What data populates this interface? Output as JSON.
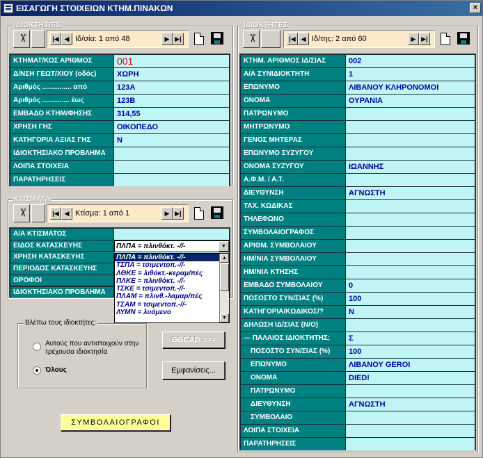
{
  "window": {
    "title": "ΕΙΣΑΓΩΓΗ ΣΤΟΙΧΕΙΩΝ ΚΤΗΜ.ΠΙΝΑΚΩΝ",
    "close": "×"
  },
  "properties_group": {
    "label": "ΙΔΙΟΚΤΗΣΙΕΣ",
    "nav": {
      "first": "|◀",
      "prev": "◀",
      "text": "Ιδ/σία: 1 από 48",
      "next": "▶",
      "last": "▶|"
    },
    "rows": [
      {
        "label": "ΚΤΗΜΑΤ/ΚΟΣ ΑΡΙΘΜΟΣ",
        "value": "001"
      },
      {
        "label": "Δ/ΝΣΗ ΓΕΩΤ/ΧΙΟΥ (οδός)",
        "value": "ΧΩΡΗ"
      },
      {
        "label": "Αριθμός ............... από",
        "value": "123A"
      },
      {
        "label": "Αριθμός .............. έως",
        "value": "123B"
      },
      {
        "label": "ΕΜΒΑΔΟ ΚΤΗΜ/ΦΗΣΗΣ",
        "value": "314,55"
      },
      {
        "label": "ΧΡΗΣΗ ΓΗΣ",
        "value": "ΟΙΚΟΠΕΔΟ"
      },
      {
        "label": "ΚΑΤΗΓΟΡΙΑ ΑΞΙΑΣ ΓΗΣ",
        "value": "N"
      },
      {
        "label": "ΙΔΙΟΚΤΗΣΙΑΚΟ ΠΡΟΒΛΗΜΑ",
        "value": ""
      },
      {
        "label": "ΛΟΙΠΑ ΣΤΟΙΧΕΙΑ",
        "value": ""
      },
      {
        "label": "ΠΑΡΑΤΗΡΗΣΕΙΣ",
        "value": ""
      }
    ]
  },
  "buildings_group": {
    "label": "ΚΤΙΣΜΑΤΑ",
    "nav": {
      "first": "|◀",
      "prev": "◀",
      "text": "Κτίσμα: 1 από 1",
      "next": "▶",
      "last": "▶|"
    },
    "rows": [
      {
        "label": "Α/Α ΚΤΙΣΜΑΤΟΣ"
      },
      {
        "label": "ΕΙΔΟΣ ΚΑΤΑΣΚΕΥΗΣ"
      },
      {
        "label": "ΧΡΗΣΗ ΚΑΤΑΣΚΕΥΗΣ"
      },
      {
        "label": "ΠΕΡΙΟΔΟΣ ΚΑΤΑΣΚΕΥΗΣ"
      },
      {
        "label": "ΟΡΟΦΟΙ"
      },
      {
        "label": "ΙΔΙΟΚΤΗΣΙΑΚΟ ΠΡΟΒΛΗΜΑ"
      }
    ],
    "combo_value": "ΠΛΠΑ = πλινθόκτ. -//-",
    "combo_arrow": "▼",
    "options": [
      "ΠΛΠΑ = πλινθόκτ. -//-",
      "ΤΣΠΑ = τσιμεντοπ.-//-",
      "ΛΘΚΕ = λιθόκτ.-κεραμ/πές",
      "ΠΛΚΕ = πλινθόκτ. -//-",
      "ΤΣΚΕ = τσιμεντοπ.-//-",
      "ΠΛΑΜ = πλινθ.-λαμαρ/πές",
      "ΤΣΑΜ = τσιμεντοπ.-//-",
      "ΛΥΜΝ = λυόμενο"
    ],
    "scroll_up": "▲",
    "scroll_down": "▼"
  },
  "view_owners": {
    "label": "Βλέπω τους ιδιοκτήτες:",
    "option1": "Αυτούς που αντιστοιχούν στην τρέχουσα ιδιοκτησία",
    "option2": "Όλους"
  },
  "buttons": {
    "ggcad": "GGCAD >>>",
    "display": "Εμφανίσεις...",
    "notaries": "ΣΥΜΒΟΛΑΙΟΓΡΑΦΟΙ"
  },
  "owners_group": {
    "label": "ΙΔΙΟΚΤΗΤΕΣ",
    "nav": {
      "first": "|◀",
      "prev": "◀",
      "text": "Ιδ/της: 2 από 60",
      "next": "▶",
      "last": "▶|"
    },
    "rows": [
      {
        "label": "ΚΤΗΜ. ΑΡΙΘΜΟΣ ΙΔ/ΣΙΑΣ",
        "value": "002"
      },
      {
        "label": "Α/Α ΣΥΝΙΔΙΟΚΤΗΤΗ",
        "value": "1"
      },
      {
        "label": "ΕΠΩΝΥΜΟ",
        "value": "ΛΙΒΑΝΟΥ ΚΛΗΡΟΝΟΜΟΙ"
      },
      {
        "label": "ΟΝΟΜΑ",
        "value": "ΟΥΡΑΝΙΑ"
      },
      {
        "label": "ΠΑΤΡΩΝΥΜΟ",
        "value": ""
      },
      {
        "label": "ΜΗΤΡΩΝΥΜΟ",
        "value": ""
      },
      {
        "label": "ΓΕΝΟΣ ΜΗΤΕΡΑΣ",
        "value": ""
      },
      {
        "label": "ΕΠΩΝΥΜΟ ΣΥΖΥΓΟΥ",
        "value": ""
      },
      {
        "label": "ΟΝΟΜΑ ΣΥΖΥΓΟΥ",
        "value": "ΙΩΑΝΝΗΣ"
      },
      {
        "label": "Α.Φ.Μ. / Α.Τ.",
        "value": ""
      },
      {
        "label": "ΔΙΕΥΘΥΝΣΗ",
        "value": "ΑΓΝΩΣΤΗ"
      },
      {
        "label": "ΤΑΧ. ΚΩΔΙΚΑΣ",
        "value": ""
      },
      {
        "label": "ΤΗΛΕΦΩΝΟ",
        "value": ""
      },
      {
        "label": "ΣΥΜΒΟΛΑΙΟΓΡΑΦΟΣ",
        "value": ""
      },
      {
        "label": "ΑΡΙΘΜ. ΣΥΜΒΟΛΑΙΟΥ",
        "value": ""
      },
      {
        "label": "ΗΜ/ΝΙΑ ΣΥΜΒΟΛΑΙΟΥ",
        "value": ""
      },
      {
        "label": "ΗΜ/ΝΙΑ ΚΤΗΣΗΣ",
        "value": ""
      },
      {
        "label": "ΕΜΒΑΔΟ ΣΥΜΒΟΛΑΙΟΥ",
        "value": "0"
      },
      {
        "label": "ΠΟΣΟΣΤΟ ΣΥΝ/ΣΙΑΣ (%)",
        "value": "100"
      },
      {
        "label": "ΚΑΤΗΓΟΡΙΑ/ΚΩΔΙΚΟΣ/?",
        "value": "N"
      },
      {
        "label": "ΔΗΛΩΣΗ ΙΔ/ΣΙΑΣ (Ν/Ο)",
        "value": ""
      },
      {
        "label": "--- ΠΑΛΑΙΟΣ ΙΔΙΟΚΤΗΤΗΣ;",
        "value": "Σ"
      },
      {
        "label": "ΠΟΣΟΣΤΟ ΣΥΝ/ΣΙΑΣ (%)",
        "value": "100",
        "indent": true
      },
      {
        "label": "ΕΠΩΝΥΜΟ",
        "value": "ΛΙΒΑΝΟΥ GEROI",
        "indent": true
      },
      {
        "label": "ΟΝΟΜΑ",
        "value": "DIED!",
        "indent": true
      },
      {
        "label": "ΠΑΤΡΩΝΥΜΟ",
        "value": "",
        "indent": true
      },
      {
        "label": "ΔΙΕΥΘΥΝΣΗ",
        "value": "ΑΓΝΩΣΤΗ",
        "indent": true
      },
      {
        "label": "ΣΥΜΒΟΛΑΙΟ",
        "value": "",
        "indent": true
      },
      {
        "label": "ΛΟΙΠΑ ΣΤΟΙΧΕΙΑ",
        "value": ""
      },
      {
        "label": "ΠΑΡΑΤΗΡΗΣΕΙΣ",
        "value": ""
      }
    ]
  },
  "colors": {
    "label_bg": "#008080",
    "value_bg": "#bff5f5",
    "value_text": "#0000a0",
    "nav_bg": "#fbe9c8",
    "title_bg": "#0a246a"
  }
}
